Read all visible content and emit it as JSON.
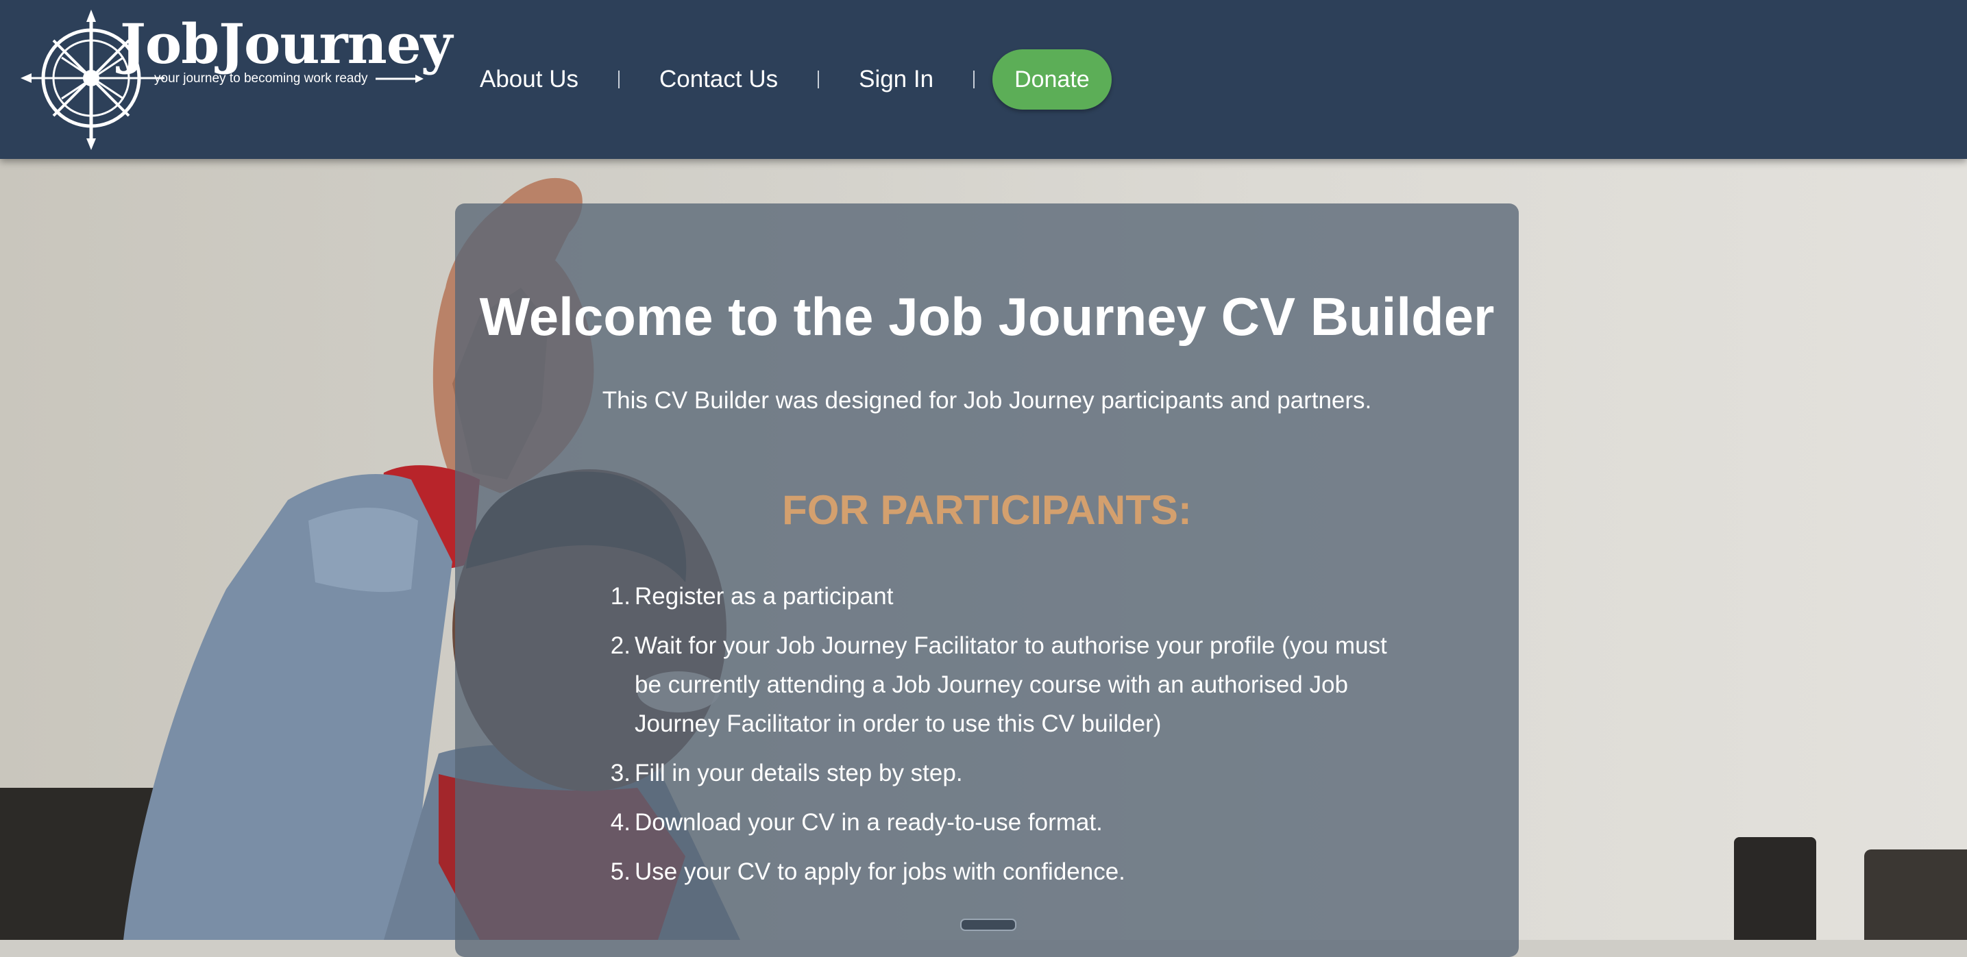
{
  "header": {
    "logo_name": "JobJourney",
    "logo_tagline": "your journey to becoming work ready",
    "nav": [
      {
        "label": "About Us"
      },
      {
        "label": "Contact Us"
      },
      {
        "label": "Sign In"
      }
    ],
    "donate_label": "Donate"
  },
  "welcome": {
    "title": "Welcome to the Job Journey CV Builder",
    "subtitle": "This CV Builder was designed for Job Journey participants and partners.",
    "section_title": "FOR PARTICIPANTS:",
    "steps": [
      {
        "number": "1.",
        "text": "Register as a participant"
      },
      {
        "number": "2.",
        "text": "Wait for your Job Journey Facilitator to authorise your profile (you must be currently attending a Job Journey course with an authorised Job Journey Facilitator in order to use this CV builder)"
      },
      {
        "number": "3.",
        "text": "Fill in your details step by step."
      },
      {
        "number": "4.",
        "text": "Download your CV in a ready-to-use format."
      },
      {
        "number": "5.",
        "text": "Use your CV to apply for jobs with confidence."
      }
    ]
  },
  "colors": {
    "header_bg": "#2d4059",
    "donate_bg": "#5cae57",
    "section_title": "#d4a06e",
    "card_bg": "rgba(88,102,118,0.78)"
  },
  "icons": {
    "logo": "compass-wheel-icon",
    "scroll": "scroll-handle"
  }
}
